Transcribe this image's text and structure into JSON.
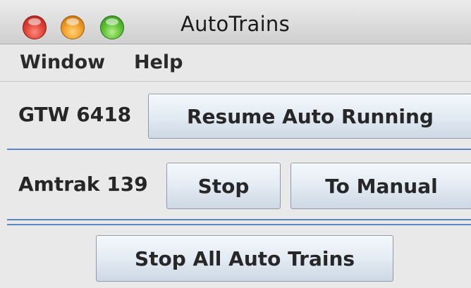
{
  "window": {
    "title": "AutoTrains"
  },
  "menu": {
    "items": [
      "Window",
      "Help"
    ]
  },
  "trains": [
    {
      "name": "GTW 6418",
      "buttons": [
        "Resume Auto Running"
      ]
    },
    {
      "name": "Amtrak 139",
      "buttons": [
        "Stop",
        "To Manual"
      ]
    }
  ],
  "footer": {
    "stop_all_label": "Stop All Auto Trains"
  },
  "colors": {
    "separator": "#5d86c9",
    "close_button": "#e0443a",
    "minimize_button": "#f2a12a",
    "zoom_button": "#5fc237"
  }
}
